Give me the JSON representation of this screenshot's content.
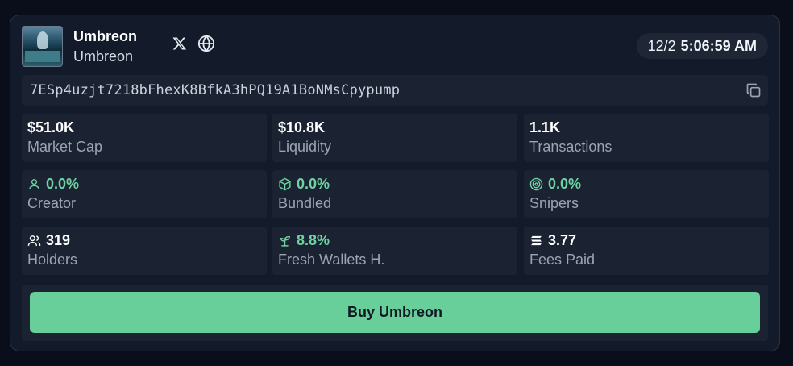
{
  "token": {
    "name": "Umbreon",
    "symbol": "Umbreon",
    "date": "12/2",
    "time": "5:06:59 AM",
    "address": "7ESp4uzjt7218bFhexK8BfkA3hPQ19A1BoNMsCpypump"
  },
  "stats": [
    {
      "value": "$51.0K",
      "label": "Market Cap"
    },
    {
      "value": "$10.8K",
      "label": "Liquidity"
    },
    {
      "value": "1.1K",
      "label": "Transactions"
    },
    {
      "value": "0.0%",
      "label": "Creator",
      "icon": "user-icon"
    },
    {
      "value": "0.0%",
      "label": "Bundled",
      "icon": "box-icon"
    },
    {
      "value": "0.0%",
      "label": "Snipers",
      "icon": "target-icon"
    },
    {
      "value": "319",
      "label": "Holders",
      "icon": "users-icon"
    },
    {
      "value": "8.8%",
      "label": "Fresh Wallets H.",
      "icon": "sprout-icon"
    },
    {
      "value": "3.77",
      "label": "Fees Paid",
      "icon": "solana-icon"
    }
  ],
  "buy_button": {
    "label": "Buy Umbreon"
  },
  "colors": {
    "background": "#0a0e1a",
    "card": "#131a29",
    "tile": "#1b2232",
    "accent_green": "#68cf9b",
    "positive_text": "#6dd3a0"
  }
}
